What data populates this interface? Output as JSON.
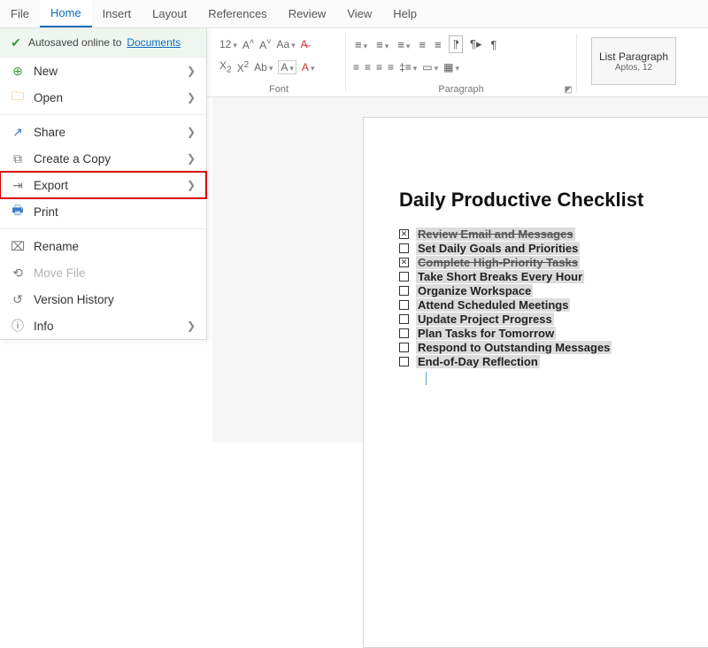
{
  "menubar": {
    "tabs": [
      "File",
      "Home",
      "Insert",
      "Layout",
      "References",
      "Review",
      "View",
      "Help"
    ],
    "active": "Home"
  },
  "autosave": {
    "prefix": "Autosaved online to",
    "link": "Documents"
  },
  "file_menu": {
    "items": [
      {
        "id": "new",
        "label": "New",
        "icon": "plus-circle-icon",
        "iconClass": "green",
        "sub": true
      },
      {
        "id": "open",
        "label": "Open",
        "icon": "folder-icon",
        "iconClass": "orange",
        "sub": true
      },
      {
        "sep": true
      },
      {
        "id": "share",
        "label": "Share",
        "icon": "share-icon",
        "iconClass": "blue",
        "sub": true
      },
      {
        "id": "copy",
        "label": "Create a Copy",
        "icon": "copy-icon",
        "sub": true
      },
      {
        "id": "export",
        "label": "Export",
        "icon": "export-icon",
        "sub": true,
        "highlight": true
      },
      {
        "id": "print",
        "label": "Print",
        "icon": "print-icon",
        "iconClass": "blue"
      },
      {
        "sep": true
      },
      {
        "id": "rename",
        "label": "Rename",
        "icon": "rename-icon"
      },
      {
        "id": "move",
        "label": "Move File",
        "icon": "move-icon",
        "disabled": true
      },
      {
        "id": "history",
        "label": "Version History",
        "icon": "history-icon"
      },
      {
        "id": "info",
        "label": "Info",
        "icon": "info-icon",
        "sub": true
      }
    ]
  },
  "ribbon": {
    "font_size_value": "12",
    "font_group_label": "Font",
    "paragraph_group_label": "Paragraph",
    "style": {
      "name": "List Paragraph",
      "sub": "Aptos, 12"
    }
  },
  "document": {
    "title": "Daily Productive Checklist",
    "items": [
      {
        "text": "Review Email and Messages",
        "checked": true
      },
      {
        "text": "Set Daily Goals and Priorities",
        "checked": false
      },
      {
        "text": "Complete High-Priority Tasks",
        "checked": true
      },
      {
        "text": "Take Short Breaks Every Hour",
        "checked": false
      },
      {
        "text": "Organize Workspace",
        "checked": false
      },
      {
        "text": "Attend Scheduled Meetings",
        "checked": false
      },
      {
        "text": "Update Project Progress",
        "checked": false
      },
      {
        "text": " Plan Tasks for Tomorrow",
        "checked": false
      },
      {
        "text": "Respond to Outstanding Messages",
        "checked": false
      },
      {
        "text": "End-of-Day Reflection",
        "checked": false
      }
    ]
  }
}
